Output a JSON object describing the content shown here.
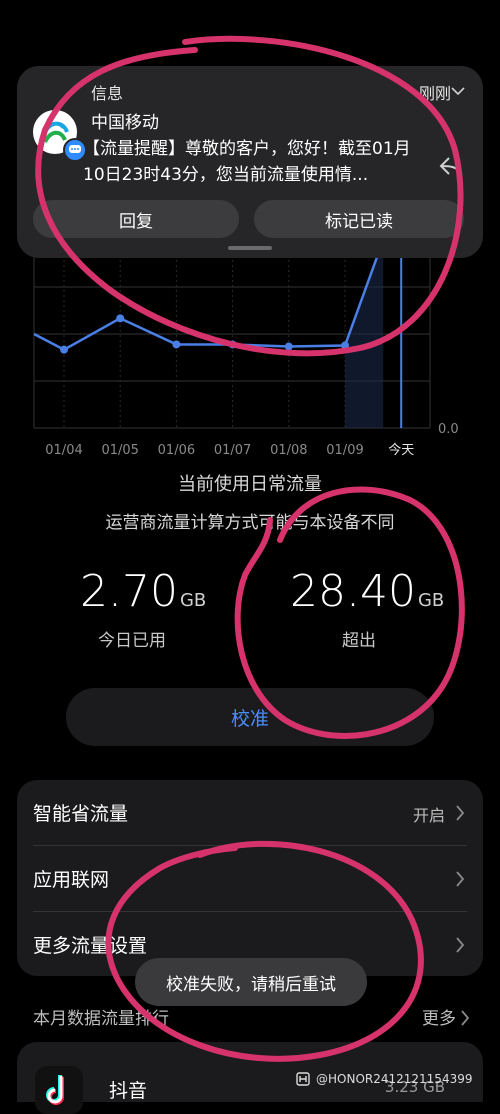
{
  "notification": {
    "app_name": "信息",
    "time": "刚刚",
    "sender": "中国移动",
    "body": "【流量提醒】尊敬的客户，您好！截至01月10日23时43分，您当前流量使用情...",
    "reply_label": "回复",
    "mark_read_label": "标记已读"
  },
  "chart_data": {
    "type": "line",
    "categories": [
      "01/04",
      "01/05",
      "01/06",
      "01/07",
      "01/08",
      "01/09",
      "今天"
    ],
    "values": [
      0.75,
      1.05,
      0.8,
      0.8,
      0.78,
      0.79,
      2.7
    ],
    "y_tick": "0.0",
    "ylim": [
      0,
      1.8
    ],
    "grid": true,
    "line_color": "#4a7fe6"
  },
  "usage": {
    "mode_label": "当前使用日常流量",
    "note": "运营商流量计算方式可能与本设备不同",
    "today_value": "2.70",
    "today_unit": "GB",
    "today_label": "今日已用",
    "over_value": "28.40",
    "over_unit": "GB",
    "over_label": "超出",
    "calibrate_label": "校准"
  },
  "settings": {
    "smart_saver_label": "智能省流量",
    "smart_saver_value": "开启",
    "app_network_label": "应用联网",
    "more_settings_label": "更多流量设置"
  },
  "toast": "校准失败，请稍后重试",
  "ranking": {
    "title": "本月数据流量排行",
    "more_label": "更多",
    "first_app_name": "抖音",
    "first_app_size": "3.23 GB"
  },
  "watermark": "@HONOR2412121154399",
  "colors": {
    "accent": "#4a8dff",
    "annotation": "#d6336c"
  }
}
